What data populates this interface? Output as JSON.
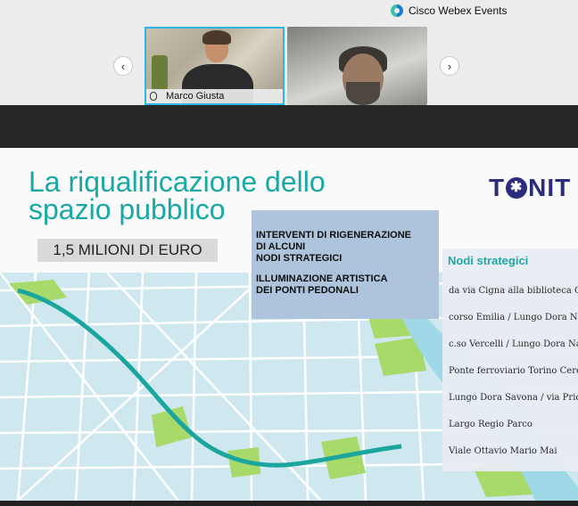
{
  "app": {
    "brand": "Cisco Webex Events",
    "brand_icon": "webex-logo-icon"
  },
  "participants": [
    {
      "name": "Marco Giusta",
      "active": true,
      "mic_icon": "microphone-icon"
    },
    {
      "name": "",
      "active": false
    }
  ],
  "nav": {
    "prev_icon": "‹",
    "next_icon": "›"
  },
  "slide": {
    "title_line1": "La riqualificazione dello",
    "title_line2": "spazio pubblico",
    "logo_left": "T",
    "logo_star": "✱",
    "logo_right": "NIT",
    "budget": "1,5 MILIONI DI EURO",
    "box_lines_a": [
      "INTERVENTI DI RIGENERAZIONE",
      "DI ALCUNI",
      "NODI STRATEGICI"
    ],
    "box_lines_b": [
      "ILLUMINAZIONE ARTISTICA",
      "DEI PONTI PEDONALI"
    ],
    "nodi_title": "Nodi strategici",
    "nodi_items": [
      "da via Cigna alla biblioteca Ca",
      "corso Emilia / Lungo Dora Na",
      "c.so Vercelli / Lungo Dora Na",
      "Ponte ferroviario Torino Cere",
      "Lungo Dora Savona / via Prio",
      "Largo Regio Parco",
      "Viale Ottavio Mario Mai"
    ]
  },
  "colors": {
    "accent": "#18a9a5",
    "active_border": "#2fb5e8",
    "logo": "#2b2d7c",
    "box": "#aec4dc",
    "park": "#a8d96b",
    "river": "#9fd8e6"
  }
}
